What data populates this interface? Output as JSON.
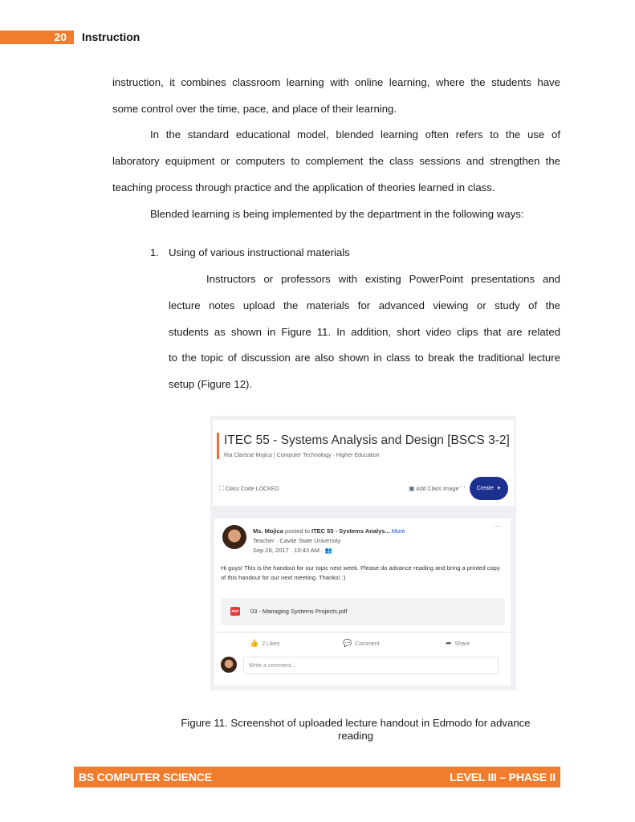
{
  "header": {
    "page_number": "20",
    "section_title": "Instruction"
  },
  "paragraphs": {
    "p1_l1": "instruction, it combines classroom learning with online learning, where the students have",
    "p1_l2": "some control over the time, pace, and place of their learning.",
    "p2_l1": "In the standard educational model, blended learning often refers to the use of",
    "p2_l2": "laboratory equipment or computers to complement the class sessions and strengthen the",
    "p2_l3": "teaching process through practice and the application of theories learned in class.",
    "p3_l1": "Blended learning is being implemented by the department in the following ways:"
  },
  "list": {
    "item1_number": "1.",
    "item1_title": "Using of various instructional materials",
    "item1_l1": "Instructors or professors with existing PowerPoint presentations and",
    "item1_l2": "lecture notes upload the materials for advanced viewing or study of the",
    "item1_l3": "students as shown in Figure 11. In addition, short video clips that are related",
    "item1_l4": "to the topic of discussion are also shown in class to break the traditional lecture",
    "item1_l5": "setup (Figure 12)."
  },
  "screenshot": {
    "class_title": "ITEC 55 - Systems Analysis and Design [BSCS 3-2]",
    "class_subtitle": "Ria Clarisse Mojica | Computer Technology · Higher Education",
    "class_code": "Class Code LOCKED",
    "add_class_image": "Add Class Image",
    "more": "···",
    "create_label": "Create",
    "post_author": "Ms. Mojica",
    "post_posted_to": "posted to",
    "post_target": "ITEC 55 - Systems Analys...",
    "post_more": "More",
    "post_role": "Teacher · Cavite State University",
    "post_date": "Sep 28, 2017 · 10:43 AM ·",
    "post_body": "Hi guys! This is the handout for our topic next week. Please do advance reading and bring a printed copy of this handout for our next meeting. Thanks! :)",
    "attachment_icon_label": "PDF",
    "attachment_name": "03 - Managing Systems Projects.pdf",
    "likes": "2 Likes",
    "comment": "Comment",
    "share": "Share",
    "comment_placeholder": "Write a comment...",
    "icons": [
      "lock-icon",
      "image-icon",
      "like-icon",
      "comment-icon",
      "share-icon",
      "pdf-icon"
    ],
    "accent_color": "#f26a36",
    "create_button_color": "#1d2f8f"
  },
  "caption": {
    "line1": "Figure 11. Screenshot of uploaded lecture handout in Edmodo for advance",
    "line2": "reading"
  },
  "footer": {
    "left": "BS COMPUTER SCIENCE",
    "right": "LEVEL III – PHASE II"
  },
  "colors": {
    "brand_orange": "#ef7d2d"
  }
}
